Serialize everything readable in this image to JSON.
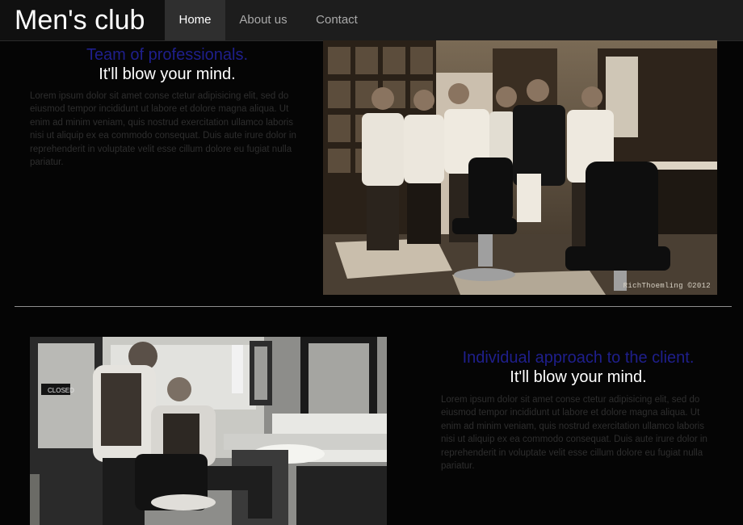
{
  "brand": {
    "name": "Men's club"
  },
  "nav": {
    "items": [
      {
        "label": "Home",
        "active": true
      },
      {
        "label": "About us",
        "active": false
      },
      {
        "label": "Contact",
        "active": false
      }
    ]
  },
  "section1": {
    "accent": "Team of professionals.",
    "tagline": "It'll blow your mind.",
    "body": "Lorem ipsum dolor sit amet conse ctetur adipisicing elit, sed do eiusmod tempor incididunt ut labore et dolore magna aliqua. Ut enim ad minim veniam, quis nostrud exercitation ullamco laboris nisi ut aliquip ex ea commodo consequat. Duis aute irure dolor in reprehenderit in voluptate velit esse cillum dolore eu fugiat nulla pariatur.",
    "photo_credit": "RichThoemling ©2012"
  },
  "section2": {
    "accent": "Individual approach to the client.",
    "tagline": "It'll blow your mind.",
    "body": "Lorem ipsum dolor sit amet conse ctetur adipisicing elit, sed do eiusmod tempor incididunt ut labore et dolore magna aliqua. Ut enim ad minim veniam, quis nostrud exercitation ullamco laboris nisi ut aliquip ex ea commodo consequat. Duis aute irure dolor in reprehenderit in voluptate velit esse cillum dolore eu fugiat nulla pariatur.",
    "shop_sign": "CLOSED"
  },
  "colors": {
    "accent_text": "#1f1f8c",
    "page_background": "#050505",
    "navbar": "#1d1d1d"
  }
}
